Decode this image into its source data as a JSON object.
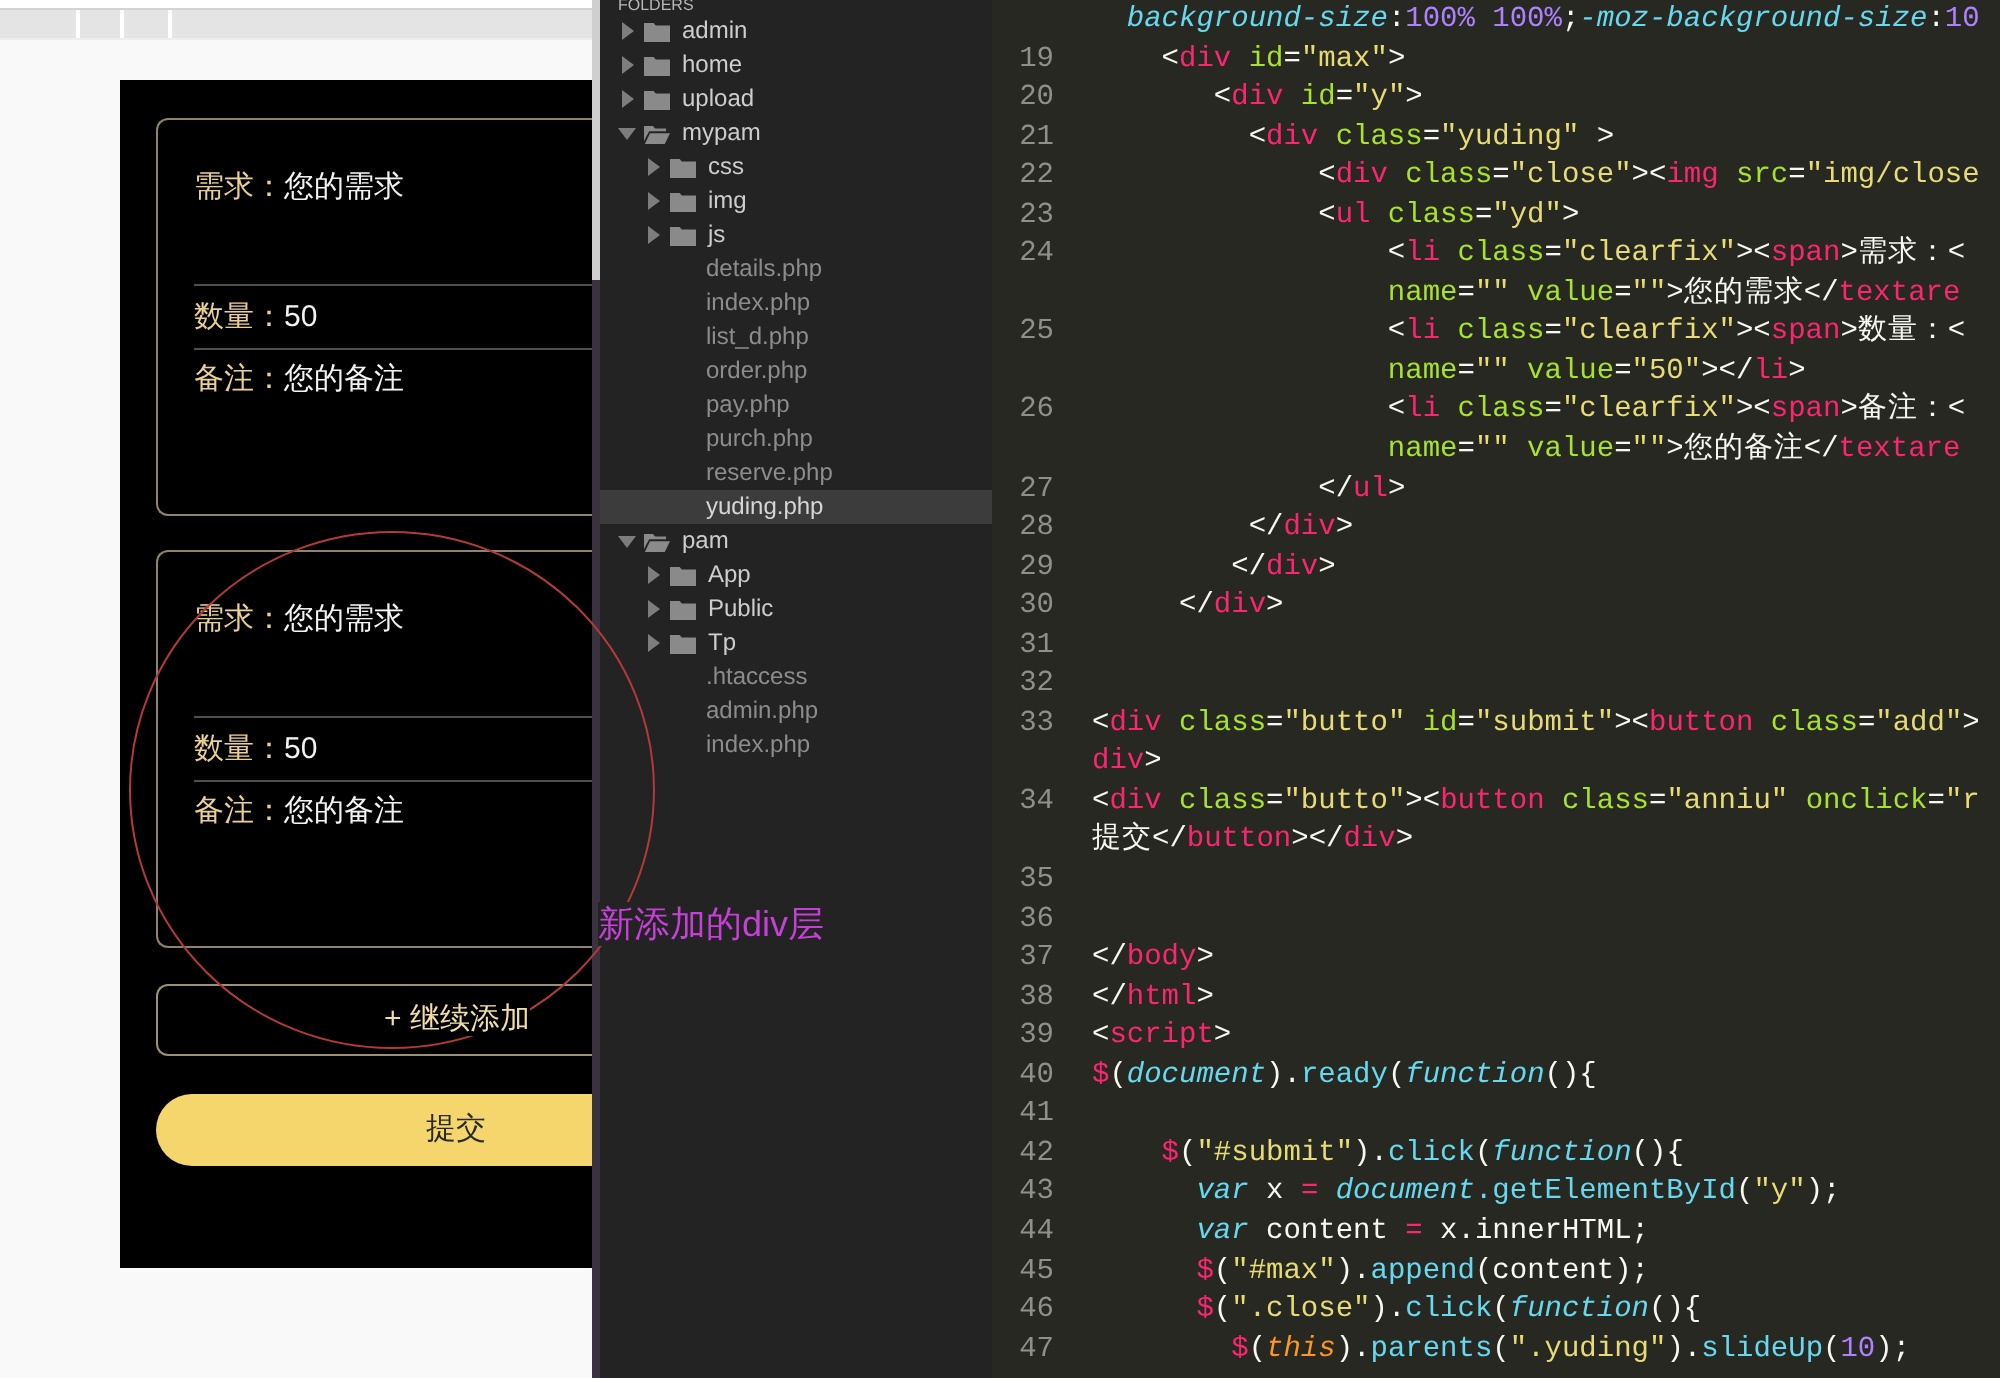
{
  "preview": {
    "cards": [
      {
        "fields": [
          {
            "kind": "textarea",
            "label": "需求：",
            "value": "您的需求"
          },
          {
            "kind": "input",
            "label": "数量：",
            "value": "50"
          },
          {
            "kind": "textarea",
            "label": "备注：",
            "value": "您的备注"
          }
        ]
      },
      {
        "fields": [
          {
            "kind": "textarea",
            "label": "需求：",
            "value": "您的需求"
          },
          {
            "kind": "input",
            "label": "数量：",
            "value": "50"
          },
          {
            "kind": "textarea",
            "label": "备注：",
            "value": "您的备注"
          }
        ]
      }
    ],
    "add_button": "+ 继续添加",
    "submit_button": "提交"
  },
  "annotation": {
    "label": "新添加的div层"
  },
  "sidebar": {
    "title": "FOLDERS",
    "items": [
      {
        "kind": "folder",
        "name": "admin",
        "expanded": false,
        "selected": false
      },
      {
        "kind": "folder",
        "name": "home",
        "expanded": false,
        "selected": false
      },
      {
        "kind": "folder",
        "name": "upload",
        "expanded": false,
        "selected": false
      },
      {
        "kind": "folder",
        "name": "mypam",
        "expanded": true,
        "selected": false,
        "children": [
          {
            "kind": "folder",
            "name": "css",
            "expanded": false,
            "selected": false
          },
          {
            "kind": "folder",
            "name": "img",
            "expanded": false,
            "selected": false
          },
          {
            "kind": "folder",
            "name": "js",
            "expanded": false,
            "selected": false
          },
          {
            "kind": "file",
            "name": "details.php",
            "selected": false
          },
          {
            "kind": "file",
            "name": "index.php",
            "selected": false
          },
          {
            "kind": "file",
            "name": "list_d.php",
            "selected": false
          },
          {
            "kind": "file",
            "name": "order.php",
            "selected": false
          },
          {
            "kind": "file",
            "name": "pay.php",
            "selected": false
          },
          {
            "kind": "file",
            "name": "purch.php",
            "selected": false
          },
          {
            "kind": "file",
            "name": "reserve.php",
            "selected": false
          },
          {
            "kind": "file",
            "name": "yuding.php",
            "selected": true
          }
        ]
      },
      {
        "kind": "folder",
        "name": "pam",
        "expanded": true,
        "selected": false,
        "children": [
          {
            "kind": "folder",
            "name": "App",
            "expanded": false,
            "selected": false
          },
          {
            "kind": "folder",
            "name": "Public",
            "expanded": false,
            "selected": false
          },
          {
            "kind": "folder",
            "name": "Tp",
            "expanded": false,
            "selected": false
          },
          {
            "kind": "file",
            "name": ".htaccess",
            "selected": false
          },
          {
            "kind": "file",
            "name": "admin.php",
            "selected": false
          },
          {
            "kind": "file",
            "name": "index.php",
            "selected": false
          }
        ]
      }
    ]
  },
  "editor": {
    "lines": [
      {
        "rows": [
          {
            "tokens": [
              {
                "kind": "type",
                "text": "  background-size"
              },
              {
                "kind": "plain",
                "text": ":"
              },
              {
                "kind": "number",
                "text": "100% 100%"
              },
              {
                "kind": "plain",
                "text": ";"
              },
              {
                "kind": "type",
                "text": "-moz-background-size"
              },
              {
                "kind": "plain",
                "text": ":"
              },
              {
                "kind": "number",
                "text": "10"
              }
            ]
          }
        ]
      },
      {
        "number": "19",
        "rows": [
          {
            "tokens": [
              {
                "kind": "plain",
                "text": "    <"
              },
              {
                "kind": "tag",
                "text": "div"
              },
              {
                "kind": "attr",
                "text": " id"
              },
              {
                "kind": "plain",
                "text": "="
              },
              {
                "kind": "string",
                "text": "\"max\""
              },
              {
                "kind": "plain",
                "text": ">"
              }
            ]
          }
        ]
      },
      {
        "number": "20",
        "rows": [
          {
            "tokens": [
              {
                "kind": "plain",
                "text": "       <"
              },
              {
                "kind": "tag",
                "text": "div"
              },
              {
                "kind": "attr",
                "text": " id"
              },
              {
                "kind": "plain",
                "text": "="
              },
              {
                "kind": "string",
                "text": "\"y\""
              },
              {
                "kind": "plain",
                "text": ">"
              }
            ]
          }
        ]
      },
      {
        "number": "21",
        "rows": [
          {
            "tokens": [
              {
                "kind": "plain",
                "text": "         <"
              },
              {
                "kind": "tag",
                "text": "div"
              },
              {
                "kind": "attr",
                "text": " class"
              },
              {
                "kind": "plain",
                "text": "="
              },
              {
                "kind": "string",
                "text": "\"yuding\""
              },
              {
                "kind": "plain",
                "text": " >"
              }
            ]
          }
        ]
      },
      {
        "number": "22",
        "rows": [
          {
            "tokens": [
              {
                "kind": "plain",
                "text": "             <"
              },
              {
                "kind": "tag",
                "text": "div"
              },
              {
                "kind": "attr",
                "text": " class"
              },
              {
                "kind": "plain",
                "text": "="
              },
              {
                "kind": "string",
                "text": "\"close\""
              },
              {
                "kind": "plain",
                "text": "><"
              },
              {
                "kind": "tag",
                "text": "img"
              },
              {
                "kind": "attr",
                "text": " src"
              },
              {
                "kind": "plain",
                "text": "="
              },
              {
                "kind": "string",
                "text": "\"img/close"
              }
            ]
          }
        ]
      },
      {
        "number": "23",
        "rows": [
          {
            "tokens": [
              {
                "kind": "plain",
                "text": "             <"
              },
              {
                "kind": "tag",
                "text": "ul"
              },
              {
                "kind": "attr",
                "text": " class"
              },
              {
                "kind": "plain",
                "text": "="
              },
              {
                "kind": "string",
                "text": "\"yd\""
              },
              {
                "kind": "plain",
                "text": ">"
              }
            ]
          }
        ]
      },
      {
        "number": "24",
        "rows": [
          {
            "tokens": [
              {
                "kind": "plain",
                "text": "                 <"
              },
              {
                "kind": "tag",
                "text": "li"
              },
              {
                "kind": "attr",
                "text": " class"
              },
              {
                "kind": "plain",
                "text": "="
              },
              {
                "kind": "string",
                "text": "\"clearfix\""
              },
              {
                "kind": "plain",
                "text": "><"
              },
              {
                "kind": "tag",
                "text": "span"
              },
              {
                "kind": "plain",
                "text": ">需求：<"
              }
            ]
          },
          {
            "tokens": [
              {
                "kind": "attr",
                "text": "                 name"
              },
              {
                "kind": "plain",
                "text": "="
              },
              {
                "kind": "string",
                "text": "\"\""
              },
              {
                "kind": "attr",
                "text": " value"
              },
              {
                "kind": "plain",
                "text": "="
              },
              {
                "kind": "string",
                "text": "\"\""
              },
              {
                "kind": "plain",
                "text": ">您的需求</"
              },
              {
                "kind": "tag",
                "text": "textare"
              }
            ]
          }
        ]
      },
      {
        "number": "25",
        "rows": [
          {
            "tokens": [
              {
                "kind": "plain",
                "text": "                 <"
              },
              {
                "kind": "tag",
                "text": "li"
              },
              {
                "kind": "attr",
                "text": " class"
              },
              {
                "kind": "plain",
                "text": "="
              },
              {
                "kind": "string",
                "text": "\"clearfix\""
              },
              {
                "kind": "plain",
                "text": "><"
              },
              {
                "kind": "tag",
                "text": "span"
              },
              {
                "kind": "plain",
                "text": ">数量：<"
              }
            ]
          },
          {
            "tokens": [
              {
                "kind": "attr",
                "text": "                 name"
              },
              {
                "kind": "plain",
                "text": "="
              },
              {
                "kind": "string",
                "text": "\"\""
              },
              {
                "kind": "attr",
                "text": " value"
              },
              {
                "kind": "plain",
                "text": "="
              },
              {
                "kind": "string",
                "text": "\"50\""
              },
              {
                "kind": "plain",
                "text": "></"
              },
              {
                "kind": "tag",
                "text": "li"
              },
              {
                "kind": "plain",
                "text": ">"
              }
            ]
          }
        ]
      },
      {
        "number": "26",
        "rows": [
          {
            "tokens": [
              {
                "kind": "plain",
                "text": "                 <"
              },
              {
                "kind": "tag",
                "text": "li"
              },
              {
                "kind": "attr",
                "text": " class"
              },
              {
                "kind": "plain",
                "text": "="
              },
              {
                "kind": "string",
                "text": "\"clearfix\""
              },
              {
                "kind": "plain",
                "text": "><"
              },
              {
                "kind": "tag",
                "text": "span"
              },
              {
                "kind": "plain",
                "text": ">备注：<"
              }
            ]
          },
          {
            "tokens": [
              {
                "kind": "attr",
                "text": "                 name"
              },
              {
                "kind": "plain",
                "text": "="
              },
              {
                "kind": "string",
                "text": "\"\""
              },
              {
                "kind": "attr",
                "text": " value"
              },
              {
                "kind": "plain",
                "text": "="
              },
              {
                "kind": "string",
                "text": "\"\""
              },
              {
                "kind": "plain",
                "text": ">您的备注</"
              },
              {
                "kind": "tag",
                "text": "textare"
              }
            ]
          }
        ]
      },
      {
        "number": "27",
        "rows": [
          {
            "tokens": [
              {
                "kind": "plain",
                "text": "             </"
              },
              {
                "kind": "tag",
                "text": "ul"
              },
              {
                "kind": "plain",
                "text": ">"
              }
            ]
          }
        ]
      },
      {
        "number": "28",
        "rows": [
          {
            "tokens": [
              {
                "kind": "plain",
                "text": "         </"
              },
              {
                "kind": "tag",
                "text": "div"
              },
              {
                "kind": "plain",
                "text": ">"
              }
            ]
          }
        ]
      },
      {
        "number": "29",
        "rows": [
          {
            "tokens": [
              {
                "kind": "plain",
                "text": "        </"
              },
              {
                "kind": "tag",
                "text": "div"
              },
              {
                "kind": "plain",
                "text": ">"
              }
            ]
          }
        ]
      },
      {
        "number": "30",
        "rows": [
          {
            "tokens": [
              {
                "kind": "plain",
                "text": "     </"
              },
              {
                "kind": "tag",
                "text": "div"
              },
              {
                "kind": "plain",
                "text": ">"
              }
            ]
          }
        ]
      },
      {
        "number": "31"
      },
      {
        "number": "32"
      },
      {
        "number": "33",
        "rows": [
          {
            "tokens": [
              {
                "kind": "plain",
                "text": "<"
              },
              {
                "kind": "tag",
                "text": "div"
              },
              {
                "kind": "attr",
                "text": " class"
              },
              {
                "kind": "plain",
                "text": "="
              },
              {
                "kind": "string",
                "text": "\"butto\""
              },
              {
                "kind": "attr",
                "text": " id"
              },
              {
                "kind": "plain",
                "text": "="
              },
              {
                "kind": "string",
                "text": "\"submit\""
              },
              {
                "kind": "plain",
                "text": "><"
              },
              {
                "kind": "tag",
                "text": "button"
              },
              {
                "kind": "attr",
                "text": " class"
              },
              {
                "kind": "plain",
                "text": "="
              },
              {
                "kind": "string",
                "text": "\"add\""
              },
              {
                "kind": "plain",
                "text": ">"
              }
            ]
          },
          {
            "tokens": [
              {
                "kind": "tag",
                "text": "div"
              },
              {
                "kind": "plain",
                "text": ">"
              }
            ]
          }
        ]
      },
      {
        "number": "34",
        "rows": [
          {
            "tokens": [
              {
                "kind": "plain",
                "text": "<"
              },
              {
                "kind": "tag",
                "text": "div"
              },
              {
                "kind": "attr",
                "text": " class"
              },
              {
                "kind": "plain",
                "text": "="
              },
              {
                "kind": "string",
                "text": "\"butto\""
              },
              {
                "kind": "plain",
                "text": "><"
              },
              {
                "kind": "tag",
                "text": "button"
              },
              {
                "kind": "attr",
                "text": " class"
              },
              {
                "kind": "plain",
                "text": "="
              },
              {
                "kind": "string",
                "text": "\"anniu\""
              },
              {
                "kind": "attr",
                "text": " onclick"
              },
              {
                "kind": "plain",
                "text": "="
              },
              {
                "kind": "string",
                "text": "\"r"
              }
            ]
          },
          {
            "tokens": [
              {
                "kind": "plain",
                "text": "提交</"
              },
              {
                "kind": "tag",
                "text": "button"
              },
              {
                "kind": "plain",
                "text": "></"
              },
              {
                "kind": "tag",
                "text": "div"
              },
              {
                "kind": "plain",
                "text": ">"
              }
            ]
          }
        ]
      },
      {
        "number": "35"
      },
      {
        "number": "36"
      },
      {
        "number": "37",
        "rows": [
          {
            "tokens": [
              {
                "kind": "plain",
                "text": "</"
              },
              {
                "kind": "tag",
                "text": "body"
              },
              {
                "kind": "plain",
                "text": ">"
              }
            ]
          }
        ]
      },
      {
        "number": "38",
        "rows": [
          {
            "tokens": [
              {
                "kind": "plain",
                "text": "</"
              },
              {
                "kind": "tag",
                "text": "html"
              },
              {
                "kind": "plain",
                "text": ">"
              }
            ]
          }
        ]
      },
      {
        "number": "39",
        "rows": [
          {
            "tokens": [
              {
                "kind": "plain",
                "text": "<"
              },
              {
                "kind": "tag",
                "text": "script"
              },
              {
                "kind": "plain",
                "text": ">"
              }
            ]
          }
        ]
      },
      {
        "number": "40",
        "rows": [
          {
            "tokens": [
              {
                "kind": "tag",
                "text": "$"
              },
              {
                "kind": "plain",
                "text": "("
              },
              {
                "kind": "type",
                "text": "document"
              },
              {
                "kind": "plain",
                "text": ")."
              },
              {
                "kind": "func",
                "text": "ready"
              },
              {
                "kind": "plain",
                "text": "("
              },
              {
                "kind": "type",
                "text": "function"
              },
              {
                "kind": "plain",
                "text": "(){"
              }
            ]
          }
        ]
      },
      {
        "number": "41"
      },
      {
        "number": "42",
        "rows": [
          {
            "tokens": [
              {
                "kind": "tag",
                "text": "    $"
              },
              {
                "kind": "plain",
                "text": "("
              },
              {
                "kind": "string",
                "text": "\"#submit\""
              },
              {
                "kind": "plain",
                "text": ")."
              },
              {
                "kind": "func",
                "text": "click"
              },
              {
                "kind": "plain",
                "text": "("
              },
              {
                "kind": "type",
                "text": "function"
              },
              {
                "kind": "plain",
                "text": "(){"
              }
            ]
          }
        ]
      },
      {
        "number": "43",
        "rows": [
          {
            "tokens": [
              {
                "kind": "type",
                "text": "      var"
              },
              {
                "kind": "plain",
                "text": " x "
              },
              {
                "kind": "tag",
                "text": "="
              },
              {
                "kind": "type",
                "text": " document"
              },
              {
                "kind": "func",
                "text": ".getElementById"
              },
              {
                "kind": "plain",
                "text": "("
              },
              {
                "kind": "string",
                "text": "\"y\""
              },
              {
                "kind": "plain",
                "text": ");"
              }
            ]
          }
        ]
      },
      {
        "number": "44",
        "rows": [
          {
            "tokens": [
              {
                "kind": "type",
                "text": "      var"
              },
              {
                "kind": "plain",
                "text": " content "
              },
              {
                "kind": "tag",
                "text": "="
              },
              {
                "kind": "plain",
                "text": " x.innerHTML;"
              }
            ]
          }
        ]
      },
      {
        "number": "45",
        "rows": [
          {
            "tokens": [
              {
                "kind": "tag",
                "text": "      $"
              },
              {
                "kind": "plain",
                "text": "("
              },
              {
                "kind": "string",
                "text": "\"#max\""
              },
              {
                "kind": "plain",
                "text": ")."
              },
              {
                "kind": "func",
                "text": "append"
              },
              {
                "kind": "plain",
                "text": "(content);"
              }
            ]
          }
        ]
      },
      {
        "number": "46",
        "rows": [
          {
            "tokens": [
              {
                "kind": "tag",
                "text": "      $"
              },
              {
                "kind": "plain",
                "text": "("
              },
              {
                "kind": "string",
                "text": "\".close\""
              },
              {
                "kind": "plain",
                "text": ")."
              },
              {
                "kind": "func",
                "text": "click"
              },
              {
                "kind": "plain",
                "text": "("
              },
              {
                "kind": "type",
                "text": "function"
              },
              {
                "kind": "plain",
                "text": "(){"
              }
            ]
          }
        ]
      },
      {
        "number": "47",
        "rows": [
          {
            "tokens": [
              {
                "kind": "tag",
                "text": "        $"
              },
              {
                "kind": "plain",
                "text": "("
              },
              {
                "kind": "var",
                "text": "this"
              },
              {
                "kind": "plain",
                "text": ")."
              },
              {
                "kind": "func",
                "text": "parents"
              },
              {
                "kind": "plain",
                "text": "("
              },
              {
                "kind": "string",
                "text": "\".yuding\""
              },
              {
                "kind": "plain",
                "text": ")."
              },
              {
                "kind": "func",
                "text": "slideUp"
              },
              {
                "kind": "plain",
                "text": "("
              },
              {
                "kind": "number",
                "text": "10"
              },
              {
                "kind": "plain",
                "text": ");"
              }
            ]
          }
        ]
      }
    ]
  }
}
